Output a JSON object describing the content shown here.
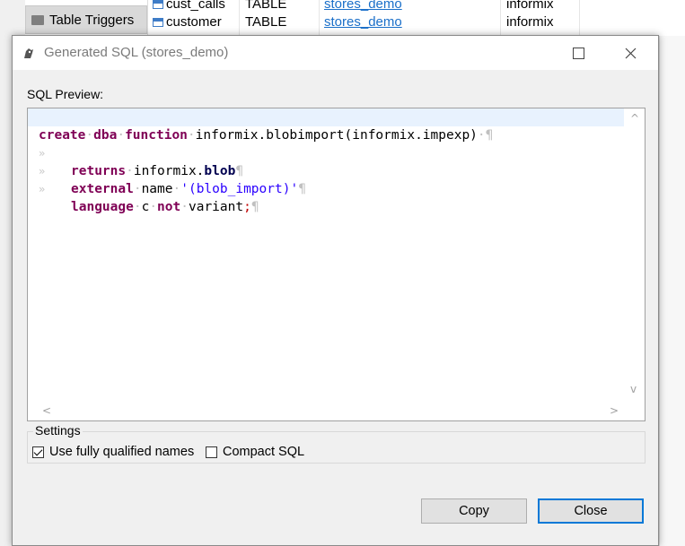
{
  "background": {
    "nav_item_label": "Table Triggers",
    "rows": [
      {
        "name": "cust_calls",
        "type": "TABLE",
        "database": "stores_demo",
        "owner": "informix"
      },
      {
        "name": "customer",
        "type": "TABLE",
        "database": "stores_demo",
        "owner": "informix"
      }
    ]
  },
  "dialog": {
    "title": "Generated SQL (stores_demo)",
    "preview_label": "SQL Preview:",
    "sql_lines": [
      {
        "text": "create dba function informix.blobimport(informix.impexp)"
      },
      {
        "text": "returns informix.blob"
      },
      {
        "text": "external name '(blob_import)'"
      },
      {
        "text": "language c not variant;"
      }
    ],
    "settings_label": "Settings",
    "options": {
      "fully_qualified": {
        "label": "Use fully qualified names",
        "checked": true
      },
      "compact_sql": {
        "label": "Compact SQL",
        "checked": false
      }
    },
    "buttons": {
      "copy": "Copy",
      "close": "Close"
    }
  },
  "colors": {
    "keyword": "#7f0055",
    "string": "#2a00ff",
    "link": "#1a6fc9",
    "accent": "#0078d7"
  }
}
